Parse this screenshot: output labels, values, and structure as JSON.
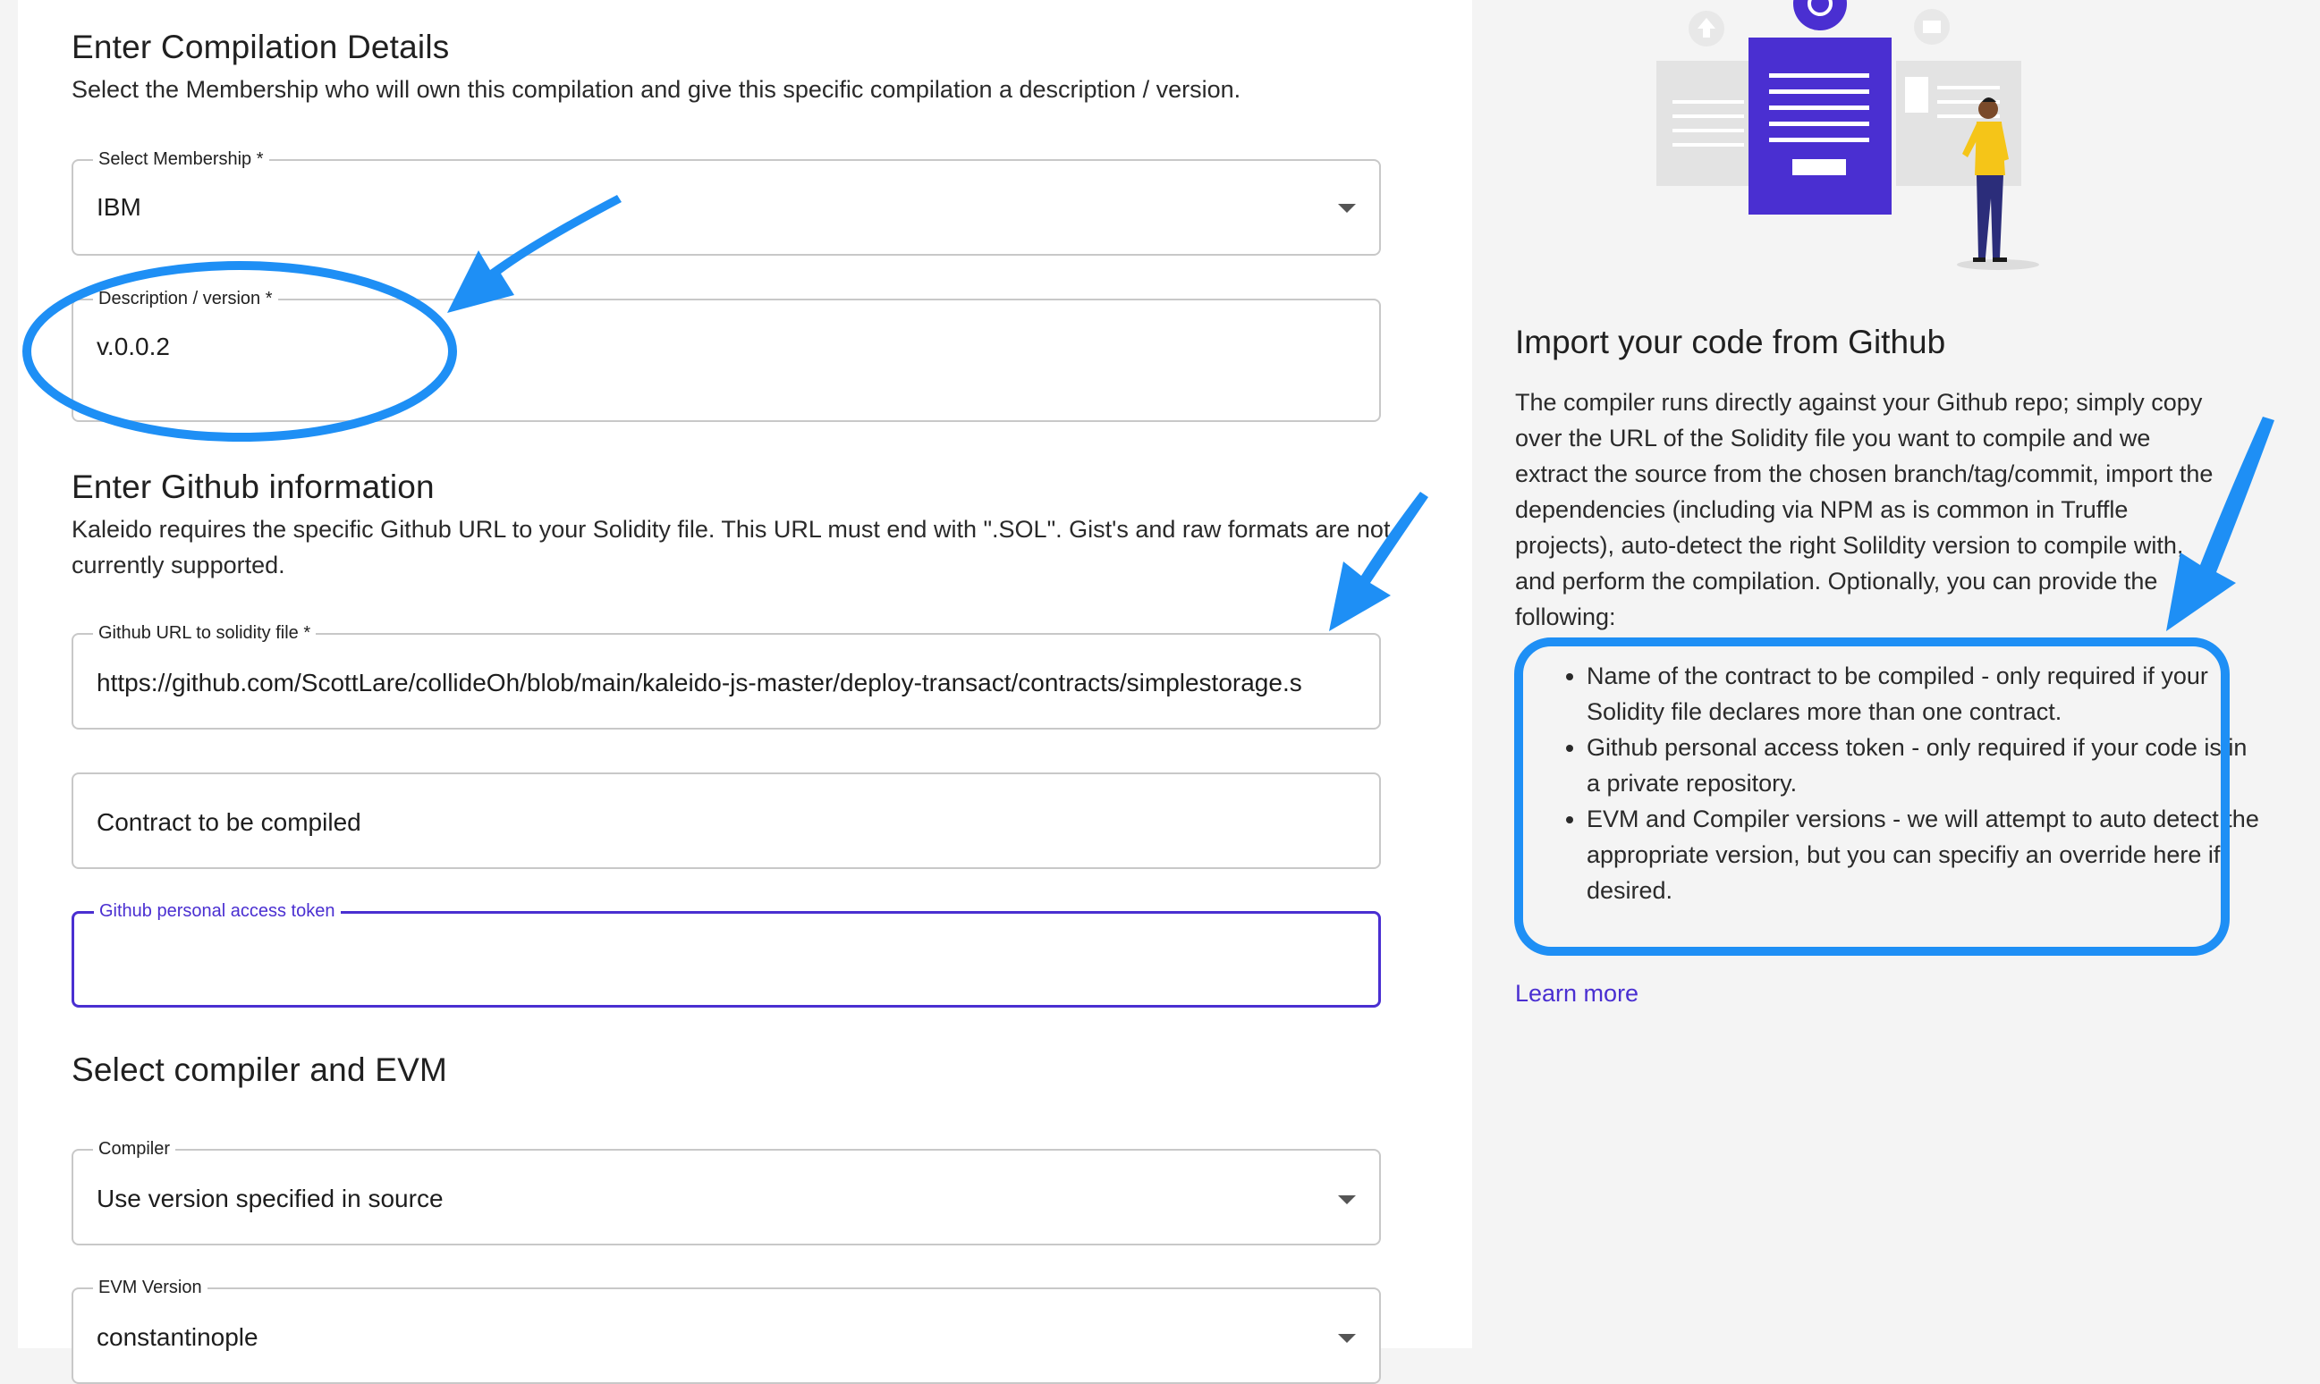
{
  "compilation": {
    "title": "Enter Compilation Details",
    "description": "Select the Membership who will own this compilation and give this specific compilation a description / version.",
    "membership": {
      "label": "Select Membership *",
      "value": "IBM"
    },
    "version": {
      "label": "Description / version *",
      "value": "v.0.0.2"
    }
  },
  "github": {
    "title": "Enter Github information",
    "description": "Kaleido requires the specific Github URL to your Solidity file. This URL must end with \".SOL\". Gist's and raw formats are not currently supported.",
    "url": {
      "label": "Github URL to solidity file *",
      "value": "https://github.com/ScottLare/collideOh/blob/main/kaleido-js-master/deploy-transact/contracts/simplestorage.s"
    },
    "contract": {
      "placeholder": "Contract to be compiled"
    },
    "token": {
      "label": "Github personal access token",
      "value": ""
    }
  },
  "compiler": {
    "title": "Select compiler and EVM",
    "compiler_field": {
      "label": "Compiler",
      "value": "Use version specified in source"
    },
    "evm_field": {
      "label": "EVM Version",
      "value": "constantinople"
    }
  },
  "import_info": {
    "title": "Import your code from Github",
    "description": "The compiler runs directly against your Github repo; simply copy over the URL of the Solidity file you want to compile and we extract the source from the chosen branch/tag/commit, import the dependencies (including via NPM as is common in Truffle projects), auto-detect the right Solildity version to compile with, and perform the compilation. Optionally, you can provide the following:",
    "bullets": [
      "Name of the contract to be compiled - only required if your Solidity file declares more than one contract.",
      "Github personal access token - only required if your code is in a private repository.",
      "EVM and Compiler versions - we will attempt to auto detect the appropriate version, but you can specifiy an override here if desired."
    ],
    "learn_more": "Learn more"
  },
  "theme": {
    "accent": "#4a2fd1",
    "annotation": "#1e8ff5",
    "figure_shirt": "#f5c518",
    "figure_pants": "#2b2d7a"
  }
}
